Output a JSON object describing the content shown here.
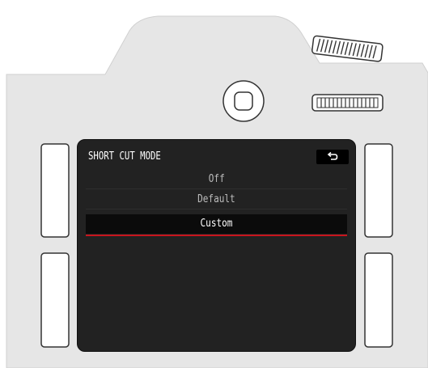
{
  "menu": {
    "title": "SHORT CUT MODE",
    "back_icon": "return-arrow-icon",
    "options": [
      "Off",
      "Default",
      "Custom"
    ],
    "selected_option": "Custom"
  },
  "colors": {
    "body": "#e6e6e6",
    "screen": "#222222",
    "selection_accent": "#c8151d"
  }
}
